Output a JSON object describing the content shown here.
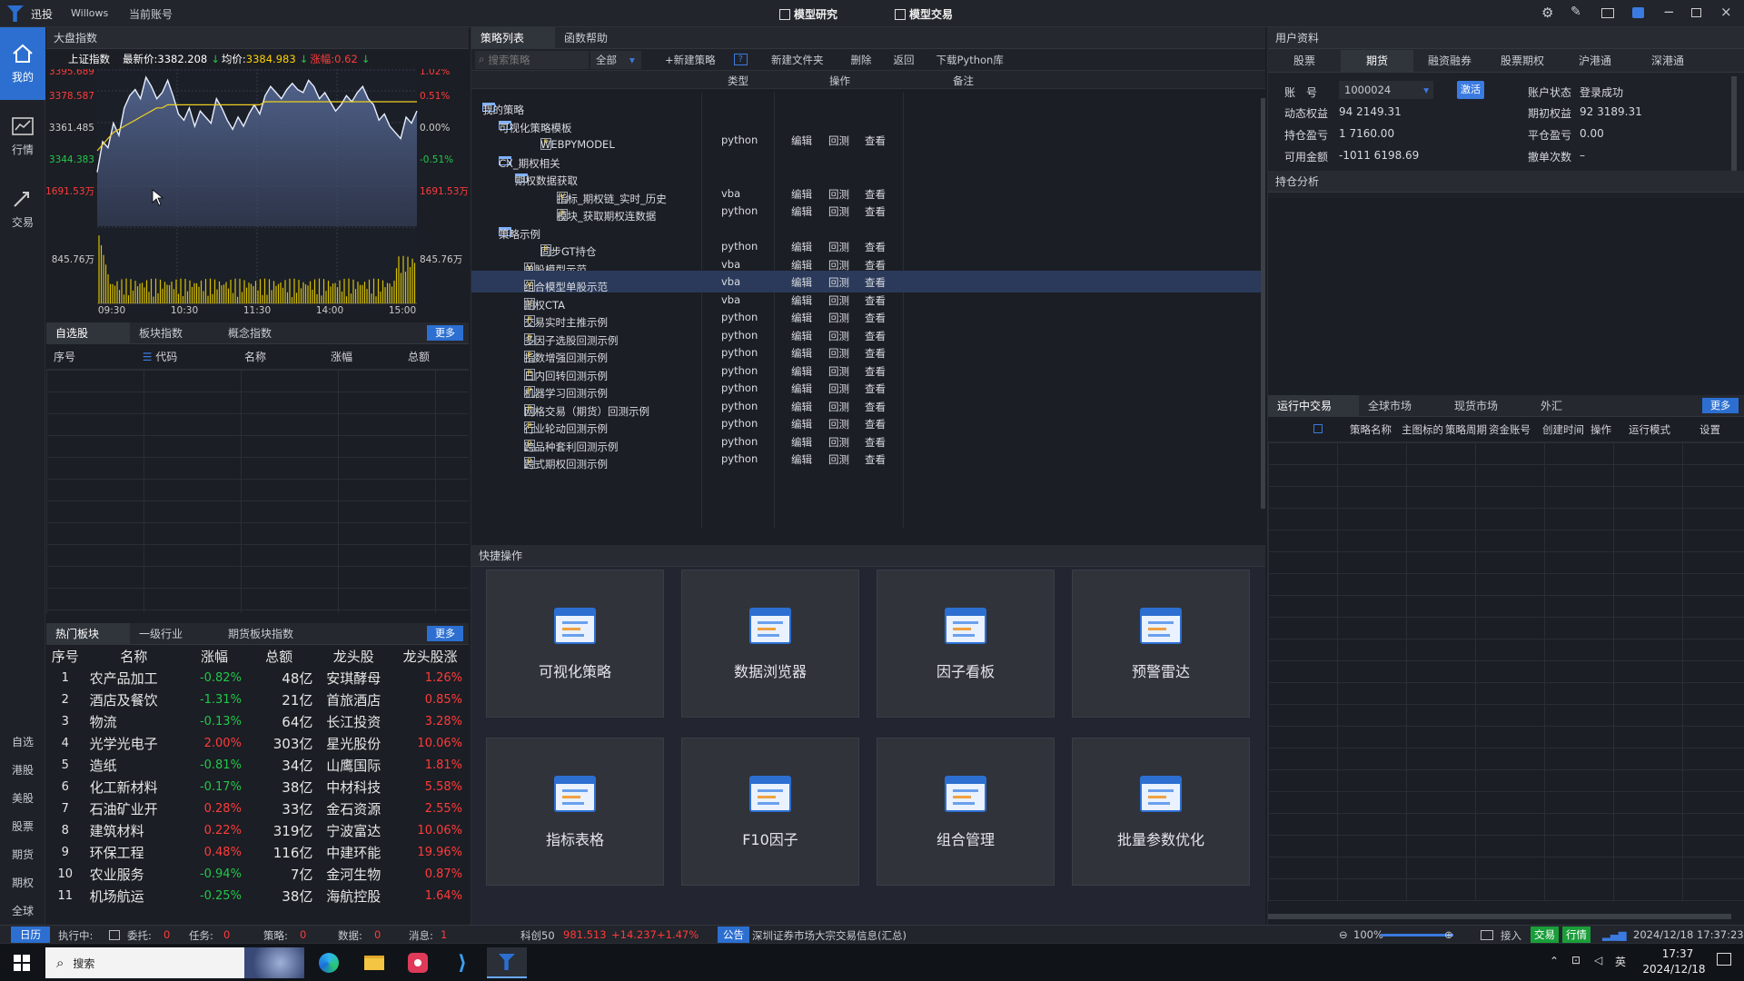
{
  "app": {
    "logo_text": "迅投",
    "user": "Willows",
    "account_menu": "当前账号",
    "mode_research": "模型研究",
    "mode_trade": "模型交易"
  },
  "nav": {
    "mine": "我的",
    "market": "行情",
    "trade": "交易",
    "markets": [
      "自选",
      "港股",
      "美股",
      "股票",
      "期货",
      "期权",
      "全球"
    ]
  },
  "index_panel": {
    "title": "大盘指数",
    "name": "上证指数",
    "last_label": "最新价:",
    "last": "3382.208",
    "avg_label": "均价:",
    "avg": "3384.983",
    "chg_label": "涨幅:",
    "chg": "0.62",
    "left_ticks": [
      "3395.689",
      "3378.587",
      "3361.485",
      "3344.383",
      "1691.53万",
      "845.76万"
    ],
    "right_ticks": [
      "1.02%",
      "0.51%",
      "0.00%",
      "-0.51%",
      "1691.53万",
      "845.76万"
    ],
    "time_ticks": [
      "09:30",
      "10:30",
      "11:30",
      "14:00",
      "15:00"
    ]
  },
  "watch": {
    "tabs": [
      "自选股",
      "板块指数",
      "概念指数"
    ],
    "more": "更多",
    "cols": [
      "序号",
      "代码",
      "名称",
      "涨幅",
      "总额"
    ]
  },
  "hot": {
    "tabs": [
      "热门板块",
      "一级行业",
      "期货板块指数"
    ],
    "more": "更多",
    "cols": [
      "序号",
      "名称",
      "涨幅",
      "总额",
      "龙头股",
      "龙头股涨"
    ],
    "rows": [
      [
        "1",
        "农产品加工",
        "-0.82%",
        "48亿",
        "安琪酵母",
        "1.26%"
      ],
      [
        "2",
        "酒店及餐饮",
        "-1.31%",
        "21亿",
        "首旅酒店",
        "0.85%"
      ],
      [
        "3",
        "物流",
        "-0.13%",
        "64亿",
        "长江投资",
        "3.28%"
      ],
      [
        "4",
        "光学光电子",
        "2.00%",
        "303亿",
        "星光股份",
        "10.06%"
      ],
      [
        "5",
        "造纸",
        "-0.81%",
        "34亿",
        "山鹰国际",
        "1.81%"
      ],
      [
        "6",
        "化工新材料",
        "-0.17%",
        "38亿",
        "中材科技",
        "5.58%"
      ],
      [
        "7",
        "石油矿业开",
        "0.28%",
        "33亿",
        "金石资源",
        "2.55%"
      ],
      [
        "8",
        "建筑材料",
        "0.22%",
        "319亿",
        "宁波富达",
        "10.06%"
      ],
      [
        "9",
        "环保工程",
        "0.48%",
        "116亿",
        "中建环能",
        "19.96%"
      ],
      [
        "10",
        "农业服务",
        "-0.94%",
        "7亿",
        "金河生物",
        "0.87%"
      ],
      [
        "11",
        "机场航运",
        "-0.25%",
        "38亿",
        "海航控股",
        "1.64%"
      ]
    ]
  },
  "strategy": {
    "tabs": [
      "策略列表",
      "函数帮助"
    ],
    "search_placeholder": "搜索策略",
    "filter": "全部",
    "new_strategy": "+新建策略",
    "help": "?",
    "new_folder": "新建文件夹",
    "delete": "删除",
    "back": "返回",
    "download": "下载Python库",
    "cols": [
      "类型",
      "操作",
      "备注"
    ],
    "ops": [
      "编辑",
      "回测",
      "查看"
    ],
    "tree": [
      {
        "label": "我的策略",
        "kind": "folder",
        "level": 0,
        "type": "",
        "ops": false
      },
      {
        "label": "可视化策略模板",
        "kind": "folder",
        "level": 1,
        "type": "",
        "ops": false
      },
      {
        "label": "WEBPYMODEL",
        "kind": "P",
        "level": 2,
        "type": "python",
        "ops": true
      },
      {
        "label": "CX_期权相关",
        "kind": "folder",
        "level": 1,
        "type": "",
        "ops": false
      },
      {
        "label": "期权数据获取",
        "kind": "folder",
        "level": 2,
        "type": "",
        "ops": false
      },
      {
        "label": "指标_期权链_实时_历史",
        "kind": "V",
        "level": 3,
        "type": "vba",
        "ops": true
      },
      {
        "label": "模块_获取期权连数据",
        "kind": "P",
        "level": 3,
        "type": "python",
        "ops": true
      },
      {
        "label": "策略示例",
        "kind": "folder",
        "level": 1,
        "type": "",
        "ops": false
      },
      {
        "label": "同步GT持仓",
        "kind": "P",
        "level": 2,
        "type": "python",
        "ops": true
      },
      {
        "label": "单股模型示范",
        "kind": "V",
        "level": 1,
        "type": "vba",
        "ops": true
      },
      {
        "label": "组合模型单股示范",
        "kind": "V",
        "level": 1,
        "type": "vba",
        "ops": true
      },
      {
        "label": "期权CTA",
        "kind": "V",
        "level": 1,
        "type": "vba",
        "ops": true
      },
      {
        "label": "交易实时主推示例",
        "kind": "P",
        "level": 1,
        "type": "python",
        "ops": true
      },
      {
        "label": "多因子选股回测示例",
        "kind": "P",
        "level": 1,
        "type": "python",
        "ops": true
      },
      {
        "label": "指数增强回测示例",
        "kind": "P",
        "level": 1,
        "type": "python",
        "ops": true
      },
      {
        "label": "日内回转回测示例",
        "kind": "P",
        "level": 1,
        "type": "python",
        "ops": true
      },
      {
        "label": "机器学习回测示例",
        "kind": "P",
        "level": 1,
        "type": "python",
        "ops": true
      },
      {
        "label": "网格交易（期货）回测示例",
        "kind": "P",
        "level": 1,
        "type": "python",
        "ops": true
      },
      {
        "label": "行业轮动回测示例",
        "kind": "P",
        "level": 1,
        "type": "python",
        "ops": true
      },
      {
        "label": "跨品种套利回测示例",
        "kind": "P",
        "level": 1,
        "type": "python",
        "ops": true
      },
      {
        "label": "跨式期权回测示例",
        "kind": "P",
        "level": 1,
        "type": "python",
        "ops": true
      }
    ]
  },
  "quick": {
    "title": "快捷操作",
    "cards": [
      "可视化策略",
      "数据浏览器",
      "因子看板",
      "预警雷达",
      "指标表格",
      "F10因子",
      "组合管理",
      "批量参数优化"
    ]
  },
  "user": {
    "title": "用户资料",
    "tabs": [
      "股票",
      "期货",
      "融资融券",
      "股票期权",
      "沪港通",
      "深港通"
    ],
    "acct_label": "账　号",
    "acct_value": "1000024",
    "activate": "激活",
    "status_label": "账户状态",
    "status_value": "登录成功",
    "rows": [
      [
        "动态权益",
        "94 2149.31",
        "期初权益",
        "92 3189.31"
      ],
      [
        "持仓盈亏",
        "1 7160.00",
        "平仓盈亏",
        "0.00"
      ],
      [
        "可用金额",
        "-1011 6198.69",
        "撤单次数",
        "–"
      ]
    ],
    "analysis": "持仓分析"
  },
  "running": {
    "tabs": [
      "运行中交易",
      "全球市场",
      "现货市场",
      "外汇"
    ],
    "more": "更多",
    "cols": [
      "策略名称",
      "主图标的",
      "策略周期",
      "资金账号",
      "创建时间",
      "操作",
      "运行模式",
      "设置"
    ]
  },
  "statusbar": {
    "calendar": "日历",
    "exec": "执行中:",
    "orders_label": "委托:",
    "orders": "0",
    "tasks_label": "任务:",
    "tasks": "0",
    "strategies_label": "策略:",
    "strategies": "0",
    "data_label": "数据:",
    "data": "0",
    "msg_label": "消息:",
    "msg": "1",
    "kc_name": "科创50",
    "kc_last": "981.513",
    "kc_chg": "+14.237",
    "kc_pct": "+1.47%",
    "notice_tag": "公告",
    "notice": "深圳证券市场大宗交易信息(汇总)",
    "zoom": "100%",
    "access": "接入",
    "trade_tag": "交易",
    "quote_tag": "行情",
    "datetime": "2024/12/18 17:37:23"
  },
  "taskbar": {
    "search": "搜索",
    "time": "17:37",
    "date": "2024/12/18",
    "ime": "英"
  },
  "chart_data": {
    "type": "line",
    "title": "上证指数",
    "ylim": [
      3344.383,
      3395.689
    ],
    "x_ticks": [
      "09:30",
      "10:30",
      "11:30",
      "14:00",
      "15:00"
    ],
    "series": [
      {
        "values": [
          3362,
          3372,
          3370,
          3378,
          3374,
          3383,
          3387,
          3389,
          3386,
          3393,
          3390,
          3386,
          3388,
          3392,
          3387,
          3381,
          3379,
          3383,
          3377,
          3382,
          3380,
          3378,
          3386,
          3383,
          3379,
          3376,
          3380,
          3377,
          3381,
          3384,
          3381,
          3387,
          3390,
          3388,
          3386,
          3389,
          3391,
          3389,
          3388,
          3392,
          3390,
          3386,
          3388,
          3385,
          3382,
          3384,
          3387,
          3385,
          3388,
          3390,
          3386,
          3384,
          3379,
          3381,
          3377,
          3375,
          3373,
          3380,
          3378,
          3382
        ]
      },
      {
        "values": [
          3369,
          3371,
          3373,
          3375,
          3376,
          3377,
          3378,
          3379,
          3380,
          3381,
          3382,
          3383,
          3383,
          3384,
          3384,
          3384,
          3384,
          3384,
          3384,
          3384,
          3384,
          3384,
          3384,
          3384,
          3384,
          3384,
          3384,
          3384,
          3384,
          3384,
          3384,
          3385,
          3385,
          3385,
          3385,
          3385,
          3385,
          3385,
          3385,
          3385,
          3385,
          3385,
          3385,
          3385,
          3385,
          3385,
          3385,
          3385,
          3385,
          3385,
          3385,
          3385,
          3385,
          3385,
          3385,
          3385,
          3385,
          3385,
          3385,
          3385
        ]
      }
    ],
    "volume_max": 1691.53
  }
}
